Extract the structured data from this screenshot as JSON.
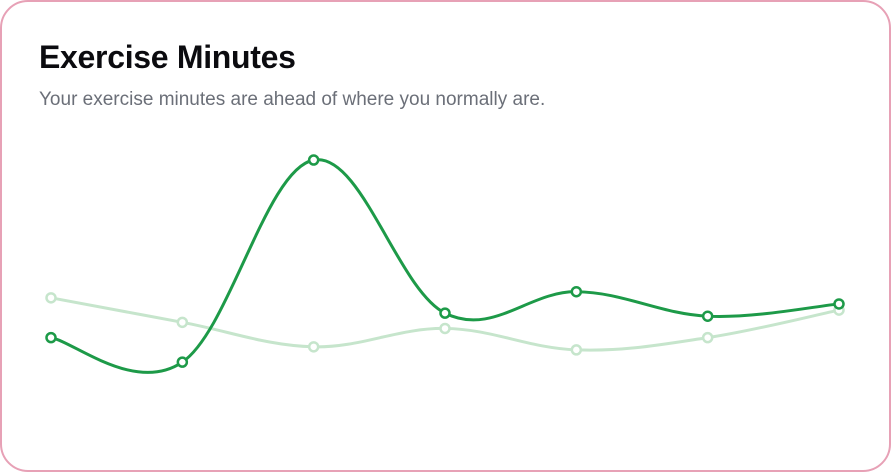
{
  "card": {
    "title": "Exercise Minutes",
    "subtitle": "Your exercise minutes are ahead of where you normally are."
  },
  "chart_data": {
    "type": "line",
    "x": [
      1,
      2,
      3,
      4,
      5,
      6,
      7
    ],
    "series": [
      {
        "key": "current",
        "color": "#1d9a48",
        "values": [
          42,
          34,
          100,
          50,
          57,
          49,
          53
        ]
      },
      {
        "key": "average",
        "color": "#c6e5cc",
        "values": [
          55,
          47,
          39,
          45,
          38,
          42,
          51
        ]
      }
    ],
    "ylim": [
      20,
      100
    ],
    "grid": false,
    "legend": "none",
    "curve": "smooth",
    "markers": "hollow-circle"
  }
}
